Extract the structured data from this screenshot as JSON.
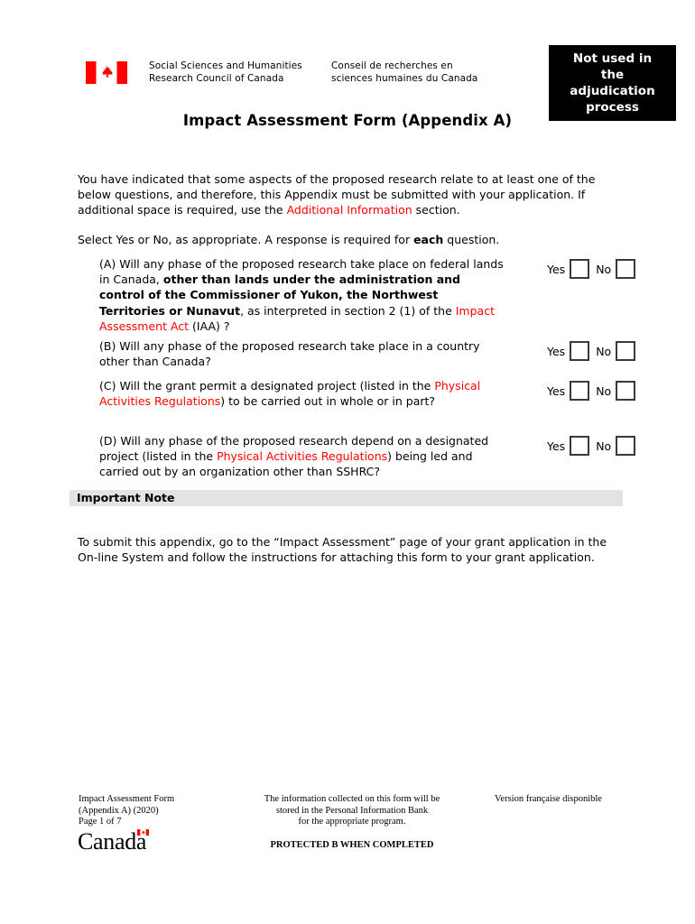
{
  "header": {
    "flag_icon": "canada-flag-icon",
    "signature_en": "Social Sciences and Humanities\nResearch Council of Canada",
    "signature_fr": "Conseil de recherches en\nsciences humaines du Canada",
    "notice_box": "Not used in\nthe\nadjudication\nprocess"
  },
  "title": "Impact Assessment Form (Appendix A)",
  "intro": {
    "paragraph1_part1": "You have indicated that some aspects of the proposed research relate to at least one of the below questions, and therefore, this Appendix must be submitted with your application. If additional space is required, use the ",
    "paragraph1_link": "Additional Information",
    "paragraph1_part2": " section.",
    "paragraph2_part1": "Select Yes or No, as appropriate. A response is required for ",
    "paragraph2_bold": "each",
    "paragraph2_part2": " question."
  },
  "answers": {
    "yes_label": "Yes",
    "no_label": "No"
  },
  "questions": [
    {
      "id": "A",
      "segments": [
        {
          "text": "(A) Will any phase of the proposed research take place on federal lands in Canada, ",
          "style": "normal"
        },
        {
          "text": "other than lands under the administration and control of the Commissioner of Yukon, the Northwest Territories or Nunavut",
          "style": "bold"
        },
        {
          "text": ", as interpreted in section 2 (1) of the ",
          "style": "normal"
        },
        {
          "text": "Impact Assessment Act",
          "style": "link"
        },
        {
          "text": " (IAA)  ?",
          "style": "normal"
        }
      ]
    },
    {
      "id": "B",
      "segments": [
        {
          "text": "(B) Will any phase of the proposed research take place in a country other than Canada?",
          "style": "normal"
        }
      ]
    },
    {
      "id": "C",
      "segments": [
        {
          "text": "(C) Will the grant permit a designated project (listed in the ",
          "style": "normal"
        },
        {
          "text": "Physical Activities Regulations",
          "style": "link"
        },
        {
          "text": ") to be carried out in whole or in part?",
          "style": "normal"
        }
      ]
    },
    {
      "id": "D",
      "segments": [
        {
          "text": "(D) Will any phase of the proposed research depend on a designated project (listed in the ",
          "style": "normal"
        },
        {
          "text": "Physical Activities Regulations",
          "style": "link"
        },
        {
          "text": ") being led and carried out by an organization other than SSHRC?",
          "style": "normal"
        }
      ]
    }
  ],
  "important_note": {
    "heading": "Important Note",
    "body": "To submit this appendix, go to the “Impact Assessment” page of your grant application in the On-line System and follow the instructions for attaching this form to your grant application."
  },
  "footer": {
    "left": "Impact Assessment Form\n(Appendix A) (2020)\nPage 1 of 7",
    "center": "The information collected on this form will be\nstored in the Personal Information Bank\nfor the appropriate program.",
    "protected": "PROTECTED B WHEN COMPLETED",
    "right": "Version française disponible",
    "wordmark": "Canada"
  },
  "colors": {
    "link_red": "#ff0000",
    "flag_red": "#ff0000",
    "note_bar_gray": "#e3e3e3",
    "notice_box_bg": "#000000"
  }
}
